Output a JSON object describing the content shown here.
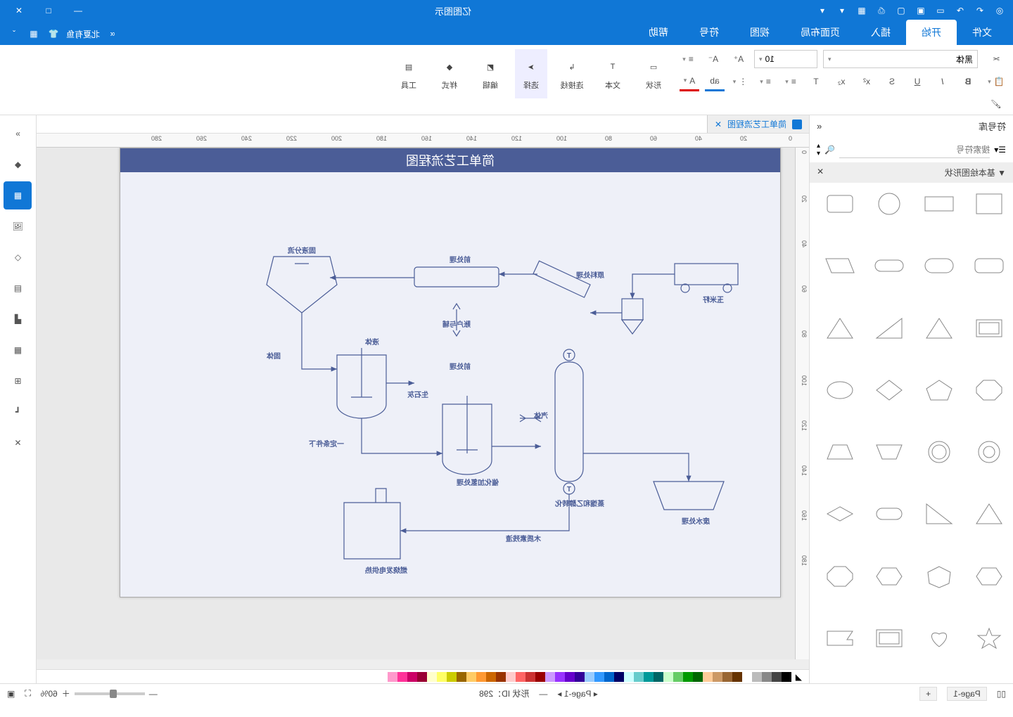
{
  "app": {
    "title": "亿图图示"
  },
  "titlebar_icons": [
    "logo",
    "undo",
    "redo",
    "save",
    "open",
    "export",
    "print",
    "new",
    "dd1",
    "dd2"
  ],
  "tabs": {
    "items": [
      "文件",
      "开始",
      "插入",
      "页面布局",
      "视图",
      "符号",
      "帮助"
    ],
    "active": 1,
    "right_label": "北夏有鱼"
  },
  "ribbon": {
    "font_name": "黑体",
    "font_size": "10",
    "big_buttons": [
      "形状",
      "文本",
      "连接线",
      "选择",
      "编辑",
      "样式",
      "工具"
    ],
    "row2_icons": [
      "B",
      "I",
      "U",
      "S",
      "x²",
      "x₂",
      "T",
      "≡",
      "≡",
      "⋮",
      "ab",
      "A",
      "A⁺",
      "A⁻",
      "≡"
    ]
  },
  "left": {
    "header": "符号库",
    "search_placeholder": "搜索符号",
    "category": "基本绘图形状"
  },
  "doc": {
    "tab_name": "简单工艺流程图",
    "page_title": "简单工艺流程图"
  },
  "diagram_labels": {
    "l1": "玉米籽",
    "l2": "原料处理",
    "l3": "前处理",
    "l4": "固液分流",
    "l5": "账户与辅",
    "l6": "固体",
    "l7": "液体",
    "l8": "生石灰",
    "l9": "前处理",
    "l10": "一定条件下",
    "l11": "汽体",
    "l12": "催化加氢处理",
    "l13": "蒸馏和乙醇转化",
    "l14": "废水处理",
    "l15": "木质素残渣",
    "l16": "燃烧发电供热"
  },
  "ruler_h": [
    "0",
    "20",
    "40",
    "60",
    "80",
    "100",
    "120",
    "140",
    "160",
    "180",
    "200",
    "220",
    "240",
    "260",
    "280"
  ],
  "ruler_v": [
    "0",
    "20",
    "40",
    "60",
    "80",
    "100",
    "120",
    "140",
    "160",
    "180"
  ],
  "colors": [
    "#000",
    "#444",
    "#888",
    "#bbb",
    "#fff",
    "#630",
    "#963",
    "#c96",
    "#fc9",
    "#060",
    "#090",
    "#6c6",
    "#cfc",
    "#066",
    "#099",
    "#6cc",
    "#cff",
    "#006",
    "#06c",
    "#39f",
    "#9cf",
    "#309",
    "#60c",
    "#93f",
    "#c9f",
    "#900",
    "#c33",
    "#f66",
    "#fcc",
    "#930",
    "#c60",
    "#f93",
    "#fc6",
    "#960",
    "#cc0",
    "#ff6",
    "#ffc",
    "#903",
    "#c06",
    "#f39",
    "#f9c"
  ],
  "status": {
    "page1": "Page-1",
    "page_add": "+",
    "page_nav": "Page-1",
    "shape_id_label": "形状 ID：",
    "shape_id_val": "298",
    "zoom": "60%"
  }
}
